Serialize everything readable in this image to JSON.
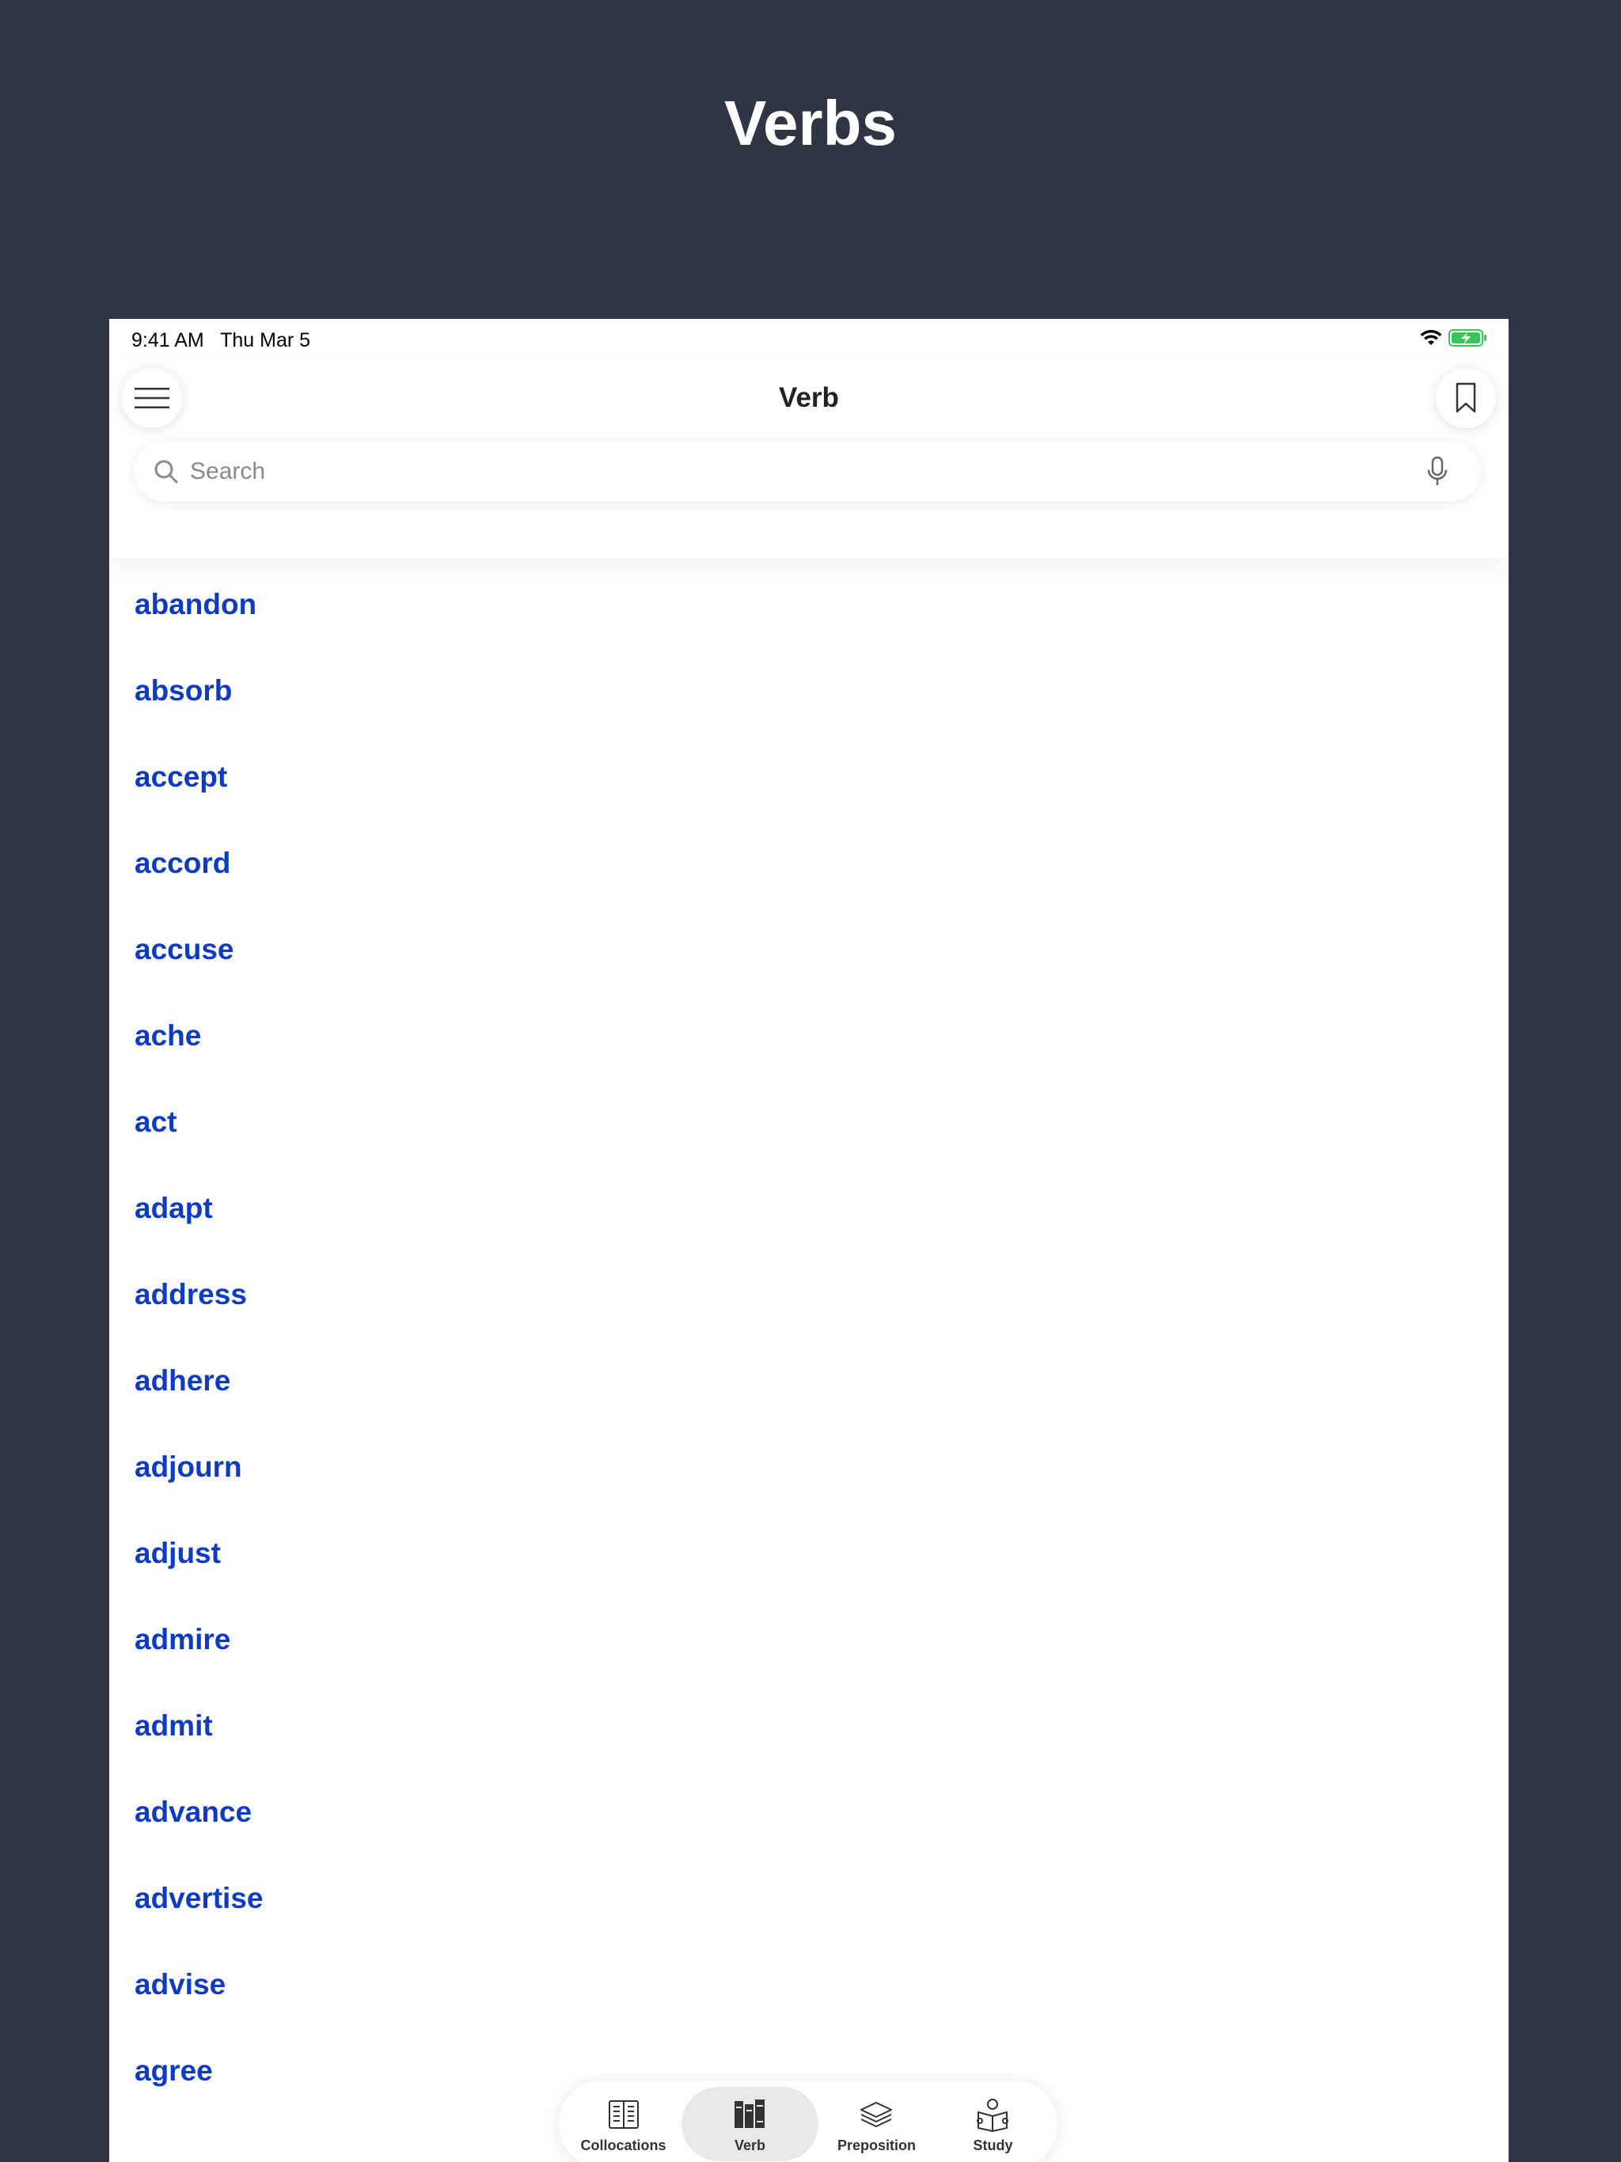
{
  "promo": {
    "title": "Verbs"
  },
  "status_bar": {
    "time": "9:41 AM",
    "date": "Thu Mar 5",
    "battery_color": "#34c759"
  },
  "header": {
    "title": "Verb",
    "menu_icon": "hamburger-icon",
    "bookmark_icon": "bookmark-icon"
  },
  "search": {
    "placeholder": "Search",
    "value": ""
  },
  "verbs": [
    "abandon",
    "absorb",
    "accept",
    "accord",
    "accuse",
    "ache",
    "act",
    "adapt",
    "address",
    "adhere",
    "adjourn",
    "adjust",
    "admire",
    "admit",
    "advance",
    "advertise",
    "advise",
    "agree"
  ],
  "tabs": [
    {
      "label": "Collocations",
      "icon": "book-columns-icon",
      "active": false
    },
    {
      "label": "Verb",
      "icon": "books-icon",
      "active": true
    },
    {
      "label": "Preposition",
      "icon": "layers-icon",
      "active": false
    },
    {
      "label": "Study",
      "icon": "reading-person-icon",
      "active": false
    }
  ],
  "colors": {
    "background": "#2f3543",
    "link": "#0d3bc4",
    "active_tab": "#e8e8e8"
  }
}
